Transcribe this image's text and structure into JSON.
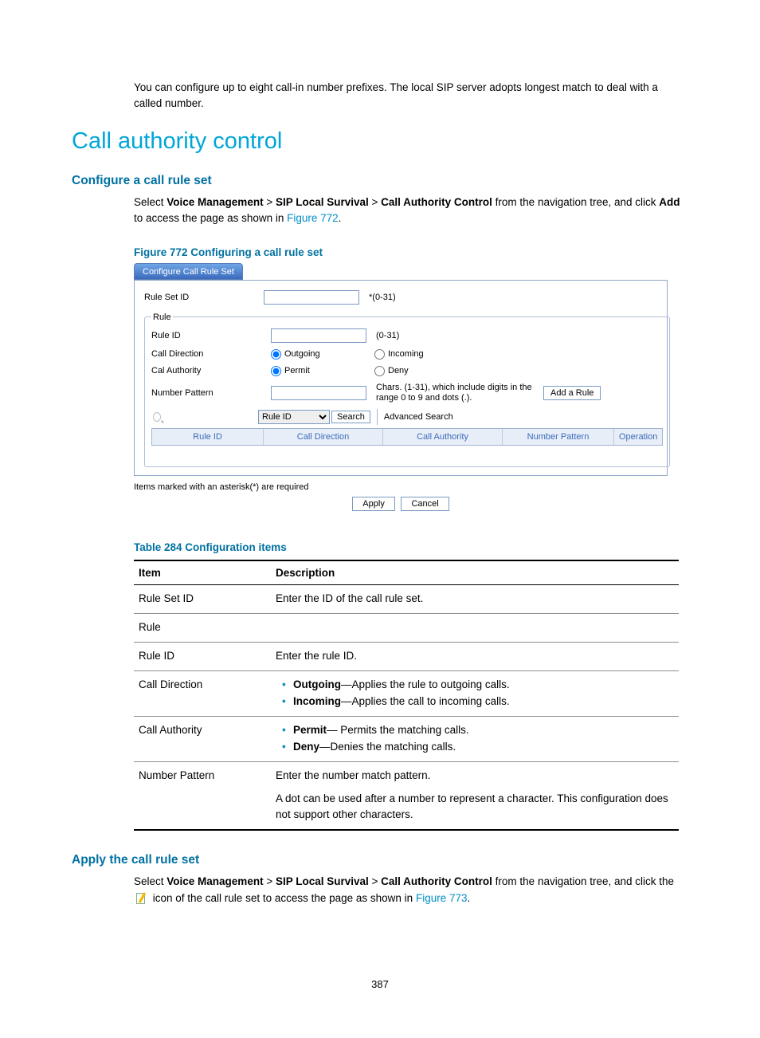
{
  "intro_text": "You can configure up to eight call-in number prefixes. The local SIP server adopts longest match to deal with a called number.",
  "h1": "Call authority control",
  "section1": {
    "title": "Configure a call rule set",
    "para_parts": {
      "t1": "Select ",
      "b1": "Voice Management",
      "t2": " > ",
      "b2": "SIP Local Survival",
      "t3": " > ",
      "b3": "Call Authority Control",
      "t4": " from the navigation tree, and click ",
      "b4": "Add",
      "t5": " to access the page as shown in ",
      "link": "Figure 772",
      "t6": "."
    },
    "figure_caption": "Figure 772 Configuring a call rule set"
  },
  "screenshot": {
    "tab": "Configure Call Rule Set",
    "rule_set_id": {
      "label": "Rule Set ID",
      "hint": "*(0-31)"
    },
    "fieldset_legend": "Rule",
    "rule_id": {
      "label": "Rule ID",
      "hint": "(0-31)"
    },
    "call_direction": {
      "label": "Call Direction",
      "opt1": "Outgoing",
      "opt2": "Incoming"
    },
    "cal_authority": {
      "label": "Cal Authority",
      "opt1": "Permit",
      "opt2": "Deny"
    },
    "number_pattern": {
      "label": "Number Pattern",
      "hint": "Chars. (1-31), which include digits in the range 0 to 9 and dots (.).",
      "add_btn": "Add a Rule"
    },
    "search": {
      "select": "Rule ID",
      "btn": "Search",
      "advanced": "Advanced Search"
    },
    "table_headers": {
      "a": "Rule ID",
      "b": "Call Direction",
      "c": "Call Authority",
      "d": "Number Pattern",
      "e": "Operation"
    },
    "foot_note": "Items marked with an asterisk(*) are required",
    "apply": "Apply",
    "cancel": "Cancel"
  },
  "table": {
    "caption": "Table 284 Configuration items",
    "head": {
      "item": "Item",
      "desc": "Description"
    },
    "rows": {
      "r1": {
        "item": "Rule Set ID",
        "desc": "Enter the ID of the call rule set."
      },
      "r2": {
        "item": "Rule",
        "desc": ""
      },
      "r3": {
        "item": "Rule ID",
        "desc": "Enter the rule ID."
      },
      "r4": {
        "item": "Call Direction",
        "li1a": "Outgoing",
        "li1b": "—Applies the rule to outgoing calls.",
        "li2a": "Incoming",
        "li2b": "—Applies the call to incoming calls."
      },
      "r5": {
        "item": "Call Authority",
        "li1a": "Permit",
        "li1b": "— Permits the matching calls.",
        "li2a": "Deny",
        "li2b": "—Denies the matching calls."
      },
      "r6": {
        "item": "Number Pattern",
        "p1": "Enter the number match pattern.",
        "p2": "A dot can be used after a number to represent a character. This configuration does not support other characters."
      }
    }
  },
  "section2": {
    "title": "Apply the call rule set",
    "para": {
      "t1": "Select ",
      "b1": "Voice Management",
      "t2": " > ",
      "b2": "SIP Local Survival",
      "t3": " > ",
      "b3": "Call Authority Control",
      "t4": " from the navigation tree, and click the ",
      "t5": " icon of the call rule set to access the page as shown in ",
      "link": "Figure 773",
      "t6": "."
    }
  },
  "page_number": "387"
}
